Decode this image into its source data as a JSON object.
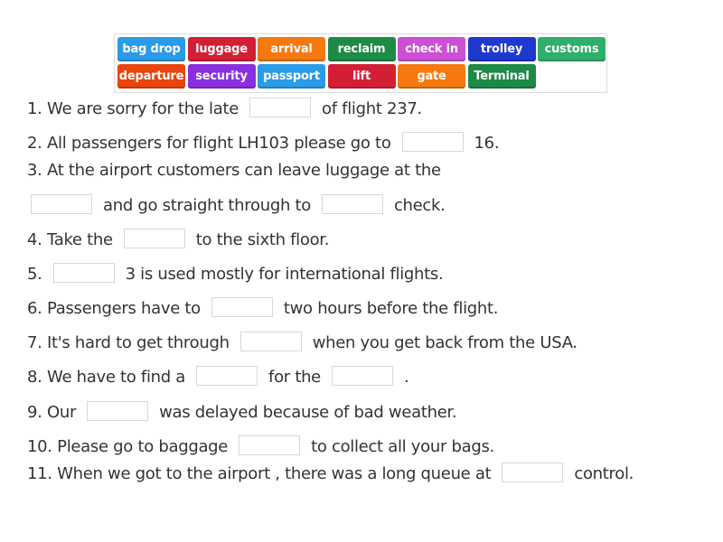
{
  "word_bank": {
    "tiles": [
      {
        "label": "bag drop",
        "color": "#2a9be8"
      },
      {
        "label": "luggage",
        "color": "#d31f36"
      },
      {
        "label": "arrival",
        "color": "#f5790f"
      },
      {
        "label": "reclaim",
        "color": "#1d8a45"
      },
      {
        "label": "check in",
        "color": "#cc4fd4"
      },
      {
        "label": "trolley",
        "color": "#1f39cf"
      },
      {
        "label": "customs",
        "color": "#2fae6c"
      },
      {
        "label": "departure",
        "color": "#e8460e"
      },
      {
        "label": "security",
        "color": "#8a2fe0"
      },
      {
        "label": "passport",
        "color": "#2a9be8"
      },
      {
        "label": "lift",
        "color": "#d31f36"
      },
      {
        "label": "gate",
        "color": "#f5790f"
      },
      {
        "label": "Terminal",
        "color": "#1d8a45"
      }
    ]
  },
  "sentences": [
    {
      "parts": [
        "1. We are sorry for the late",
        "of flight 237."
      ]
    },
    {
      "parts": [
        "2. All passengers for flight LH103 please go to",
        "16."
      ]
    },
    {
      "parts": [
        "3. At the airport customers can leave luggage at the"
      ]
    },
    {
      "parts": [
        "",
        "and go straight through to",
        "check."
      ]
    },
    {
      "parts": [
        "4. Take the",
        "to the sixth floor."
      ]
    },
    {
      "parts": [
        "5.",
        "3 is used mostly for international flights."
      ]
    },
    {
      "parts": [
        "6. Passengers have to",
        "two hours before the flight."
      ]
    },
    {
      "parts": [
        "7. It's hard to get through",
        "when you get back from the USA."
      ]
    },
    {
      "parts": [
        "8. We have to find a",
        "for the",
        "."
      ]
    },
    {
      "parts": [
        "9. Our",
        "was delayed because of bad weather."
      ]
    },
    {
      "parts": [
        "10. Please go to baggage",
        "to collect all your bags."
      ]
    },
    {
      "parts": [
        "11. When we got to the airport , there was a long queue at",
        "control."
      ]
    }
  ]
}
